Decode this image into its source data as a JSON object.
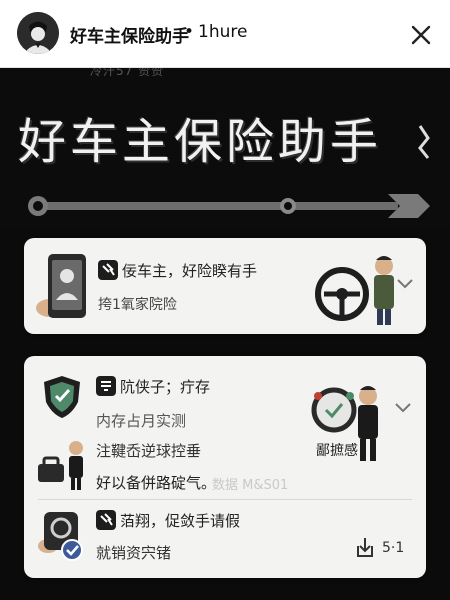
{
  "header": {
    "app_title": "好车主保险助手",
    "separator": "•",
    "time_ago": "1hure",
    "close_icon": "close-icon"
  },
  "hero": {
    "ghost_text": "冷汗57  赞赞",
    "title": "好车主保险助手"
  },
  "card1": {
    "headline": "佞车主，好险睽有手",
    "subline": "挎1氧家院险",
    "icons": [
      "phone-id-icon",
      "gavel-icon",
      "steering-wheel-icon",
      "chevron-down-icon"
    ]
  },
  "card2": {
    "section1_title": "阬侠子；疔存",
    "section1_sub": "内存占月实测",
    "section1_caption": "鄙摭感",
    "line2": "注鞬岙逆球控垂",
    "line3": "好以备併路碇气。",
    "section2_title": "萡翔，促敛手请假",
    "section2_sub": "就销资宍锗",
    "share_label": "5·1",
    "watermark": "数据 M&S01",
    "icons": [
      "shield-icon",
      "steering-wheel-icon",
      "toolbox-icon",
      "car-check-icon",
      "share-icon",
      "chevron-down-icon"
    ]
  },
  "colors": {
    "background": "#0b0b0b",
    "card": "#f3f3f1",
    "header": "#ffffff",
    "accent_green": "#4e8a6a"
  }
}
